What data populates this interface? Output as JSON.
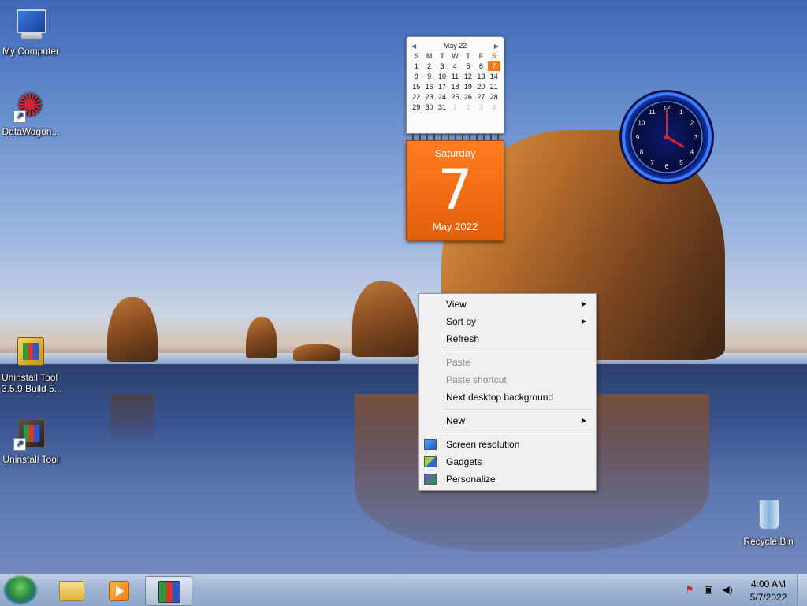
{
  "desktop_icons": [
    {
      "label": "My Computer",
      "icon": "computer-icon"
    },
    {
      "label": "DataWagon...",
      "icon": "datawagon-icon"
    },
    {
      "label": "Uninstall Tool 3.5.9 Build 5...",
      "icon": "uninstall-tool-folder-icon"
    },
    {
      "label": "Uninstall Tool",
      "icon": "uninstall-tool-icon"
    },
    {
      "label": "Recycle Bin",
      "icon": "recycle-bin-icon"
    }
  ],
  "calendar": {
    "month_header": "May 22",
    "weekday_headers": [
      "S",
      "M",
      "T",
      "W",
      "T",
      "F",
      "S"
    ],
    "weeks": [
      [
        "",
        "",
        "",
        "",
        "",
        "",
        ""
      ],
      [
        "1",
        "2",
        "3",
        "4",
        "5",
        "6",
        "7"
      ],
      [
        "8",
        "9",
        "10",
        "11",
        "12",
        "13",
        "14"
      ],
      [
        "15",
        "16",
        "17",
        "18",
        "19",
        "20",
        "21"
      ],
      [
        "22",
        "23",
        "24",
        "25",
        "26",
        "27",
        "28"
      ],
      [
        "29",
        "30",
        "31",
        "1",
        "2",
        "3",
        "4"
      ]
    ],
    "weekday": "Saturday",
    "day": "7",
    "month_year": "May 2022",
    "accent_color": "#f07a1a"
  },
  "clock": {
    "numbers": [
      "12",
      "1",
      "2",
      "3",
      "4",
      "5",
      "6",
      "7",
      "8",
      "9",
      "10",
      "11"
    ],
    "hour": 4,
    "minute": 0,
    "ring_color": "#2a6bff"
  },
  "context_menu": {
    "items": [
      {
        "label": "View",
        "submenu": true,
        "disabled": false
      },
      {
        "label": "Sort by",
        "submenu": true,
        "disabled": false
      },
      {
        "label": "Refresh",
        "submenu": false,
        "disabled": false
      },
      {
        "label": "Paste",
        "submenu": false,
        "disabled": true
      },
      {
        "label": "Paste shortcut",
        "submenu": false,
        "disabled": true
      },
      {
        "label": "Next desktop background",
        "submenu": false,
        "disabled": false
      },
      {
        "label": "New",
        "submenu": true,
        "disabled": false
      },
      {
        "label": "Screen resolution",
        "submenu": false,
        "disabled": false,
        "icon": "screen-resolution-icon"
      },
      {
        "label": "Gadgets",
        "submenu": false,
        "disabled": false,
        "icon": "gadgets-icon"
      },
      {
        "label": "Personalize",
        "submenu": false,
        "disabled": false,
        "icon": "personalize-icon"
      }
    ]
  },
  "taskbar": {
    "pinned": [
      {
        "name": "windows-explorer",
        "icon": "folder-icon",
        "active": false
      },
      {
        "name": "windows-media-player",
        "icon": "media-player-icon",
        "active": false
      },
      {
        "name": "uninstall-tool",
        "icon": "uninstall-tool-icon",
        "active": true
      }
    ],
    "tray": {
      "icons": [
        "action-center-flag-icon",
        "network-icon",
        "volume-icon"
      ],
      "time": "4:00 AM",
      "date": "5/7/2022"
    }
  }
}
